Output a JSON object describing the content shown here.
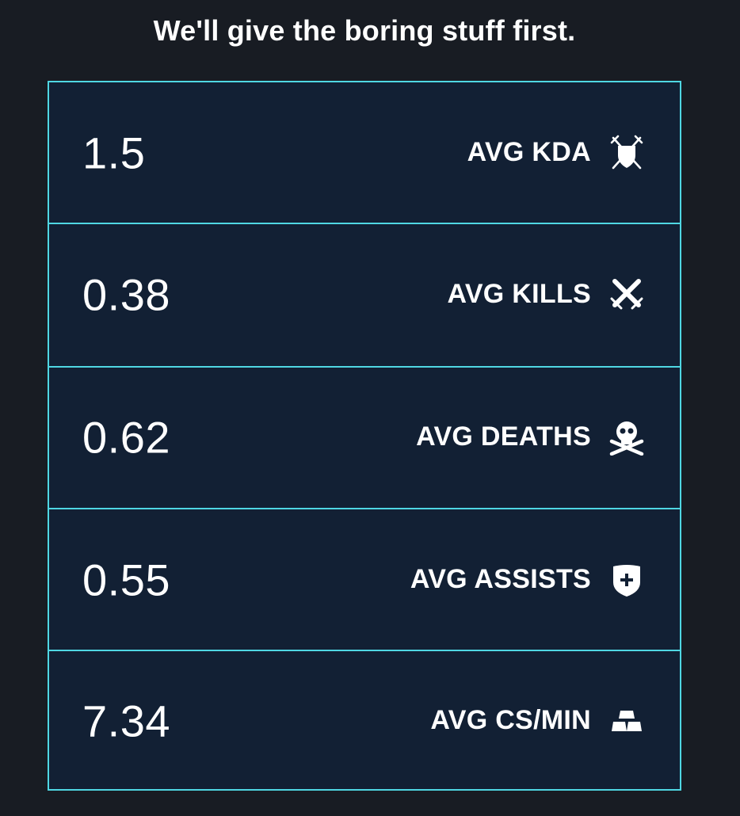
{
  "heading": "We'll give the boring stuff first.",
  "colors": {
    "background": "#181c23",
    "panel": "#122034",
    "border_accent": "#4fd7e3",
    "text": "#ffffff"
  },
  "stats": [
    {
      "value": "1.5",
      "label": "AVG KDA",
      "icon": "crossed-swords-shield-icon"
    },
    {
      "value": "0.38",
      "label": "AVG KILLS",
      "icon": "crossed-swords-icon"
    },
    {
      "value": "0.62",
      "label": "AVG DEATHS",
      "icon": "skull-crossbones-icon"
    },
    {
      "value": "0.55",
      "label": "AVG ASSISTS",
      "icon": "shield-plus-icon"
    },
    {
      "value": "7.34",
      "label": "AVG CS/MIN",
      "icon": "gold-bars-icon"
    }
  ]
}
